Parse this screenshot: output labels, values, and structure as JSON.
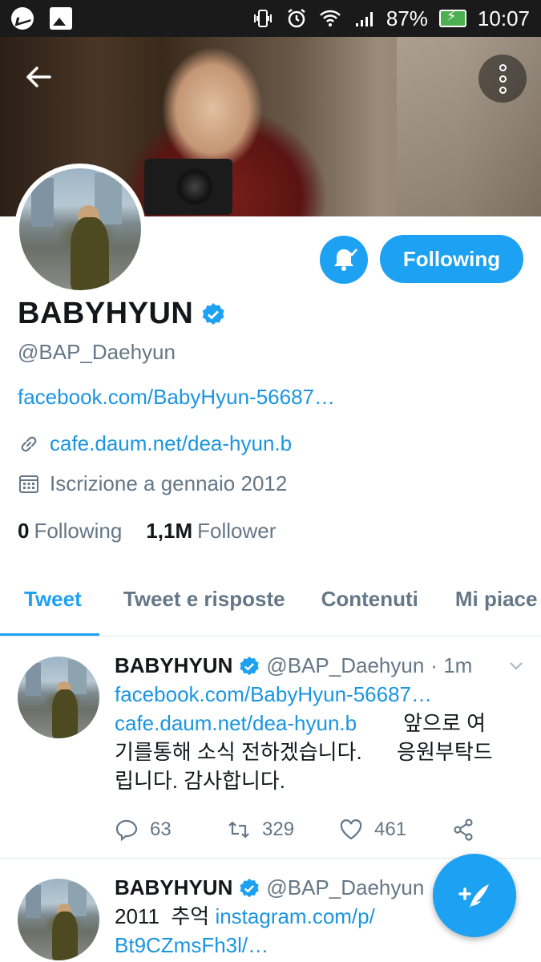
{
  "status_bar": {
    "battery": "87%",
    "time": "10:07"
  },
  "profile": {
    "display_name": "BABYHYUN",
    "handle": "@BAP_Daehyun",
    "bio_link": "facebook.com/BabyHyun-56687…",
    "website": "cafe.daum.net/dea-hyun.b",
    "joined": "Iscrizione a gennaio 2012",
    "following_count": "0",
    "following_label": "Following",
    "followers_count": "1,1M",
    "followers_label": "Follower",
    "follow_button_label": "Following"
  },
  "tabs": [
    {
      "label": "Tweet"
    },
    {
      "label": "Tweet e risposte"
    },
    {
      "label": "Contenuti"
    },
    {
      "label": "Mi piace"
    }
  ],
  "tweets": [
    {
      "name": "BABYHYUN",
      "handle": "@BAP_Daehyun",
      "time": "· 1m",
      "link1": "facebook.com/BabyHyun-56687…",
      "link2": "cafe.daum.net/dea-hyun.b",
      "text_after_link2": "앞으로 여",
      "text_line3": "기를통해 소식 전하겠습니다.      응원부탁드",
      "text_line4": "립니다. 감사합니다.",
      "replies": "63",
      "retweets": "329",
      "likes": "461"
    },
    {
      "name": "BABYHYUN",
      "handle": "@BAP_Daehyun",
      "time": "·",
      "text_prefix": "2011  추억",
      "link1": "instagram.com/p/",
      "link1_cont": "Bt9CZmsFh3l/…"
    }
  ],
  "colors": {
    "accent": "#1da1f2",
    "link": "#1b95e0",
    "secondary_text": "#657786"
  }
}
